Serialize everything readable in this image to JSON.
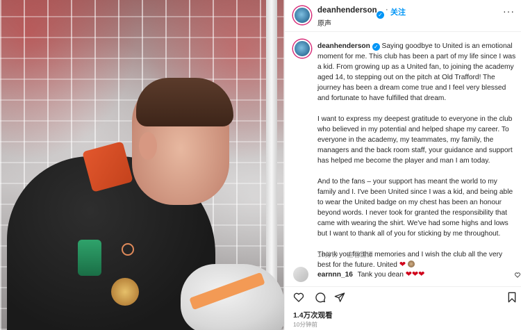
{
  "post": {
    "author": {
      "username": "deanhenderson",
      "verified_symbol": "✓",
      "follow_label": "关注",
      "subtitle": "原声",
      "more_symbol": "···"
    },
    "caption": {
      "username": "deanhenderson",
      "paragraphs": [
        "Saying goodbye to United is an emotional moment for me. This club has been a part of my life since I was a kid. From growing up as a United fan, to joining the academy aged 14, to stepping out on the pitch at Old Trafford! The journey has been a dream come true and I feel very blessed and fortunate to have fulfilled that dream.",
        "I want to express my deepest gratitude to everyone in the club who believed in my potential and helped shape my career. To everyone in the academy, my teammates, my family, the managers and the back room staff, your guidance and support has helped me become the player and man I am today.",
        "And to the fans – your support has meant the world to my family and I. I've been United since I was a kid, and being able to wear the United badge on my chest has been an honour beyond words. I never took for granted the responsibility that came with wearing the shirt. We've had some highs and lows but I want to thank all of you for sticking by me throughout.",
        "Thank you for the memories and I wish the club all the very best for the future. United"
      ],
      "emoji_heart": "❤",
      "time_ago": "10分钟",
      "translate_label": "查看翻译"
    },
    "comments": [
      {
        "username": "earnnn_16",
        "text": "Tank you dean",
        "hearts": "❤❤❤"
      }
    ],
    "stats": {
      "views": "1.4万次观看",
      "timestamp": "10分钟前"
    },
    "icons": {
      "like": "heart-icon",
      "comment": "comment-icon",
      "share": "share-icon",
      "save": "bookmark-icon"
    },
    "colors": {
      "link_blue": "#0095f6",
      "heart_red": "#d0021b",
      "text": "#262626",
      "muted": "#8e8e8e"
    }
  }
}
